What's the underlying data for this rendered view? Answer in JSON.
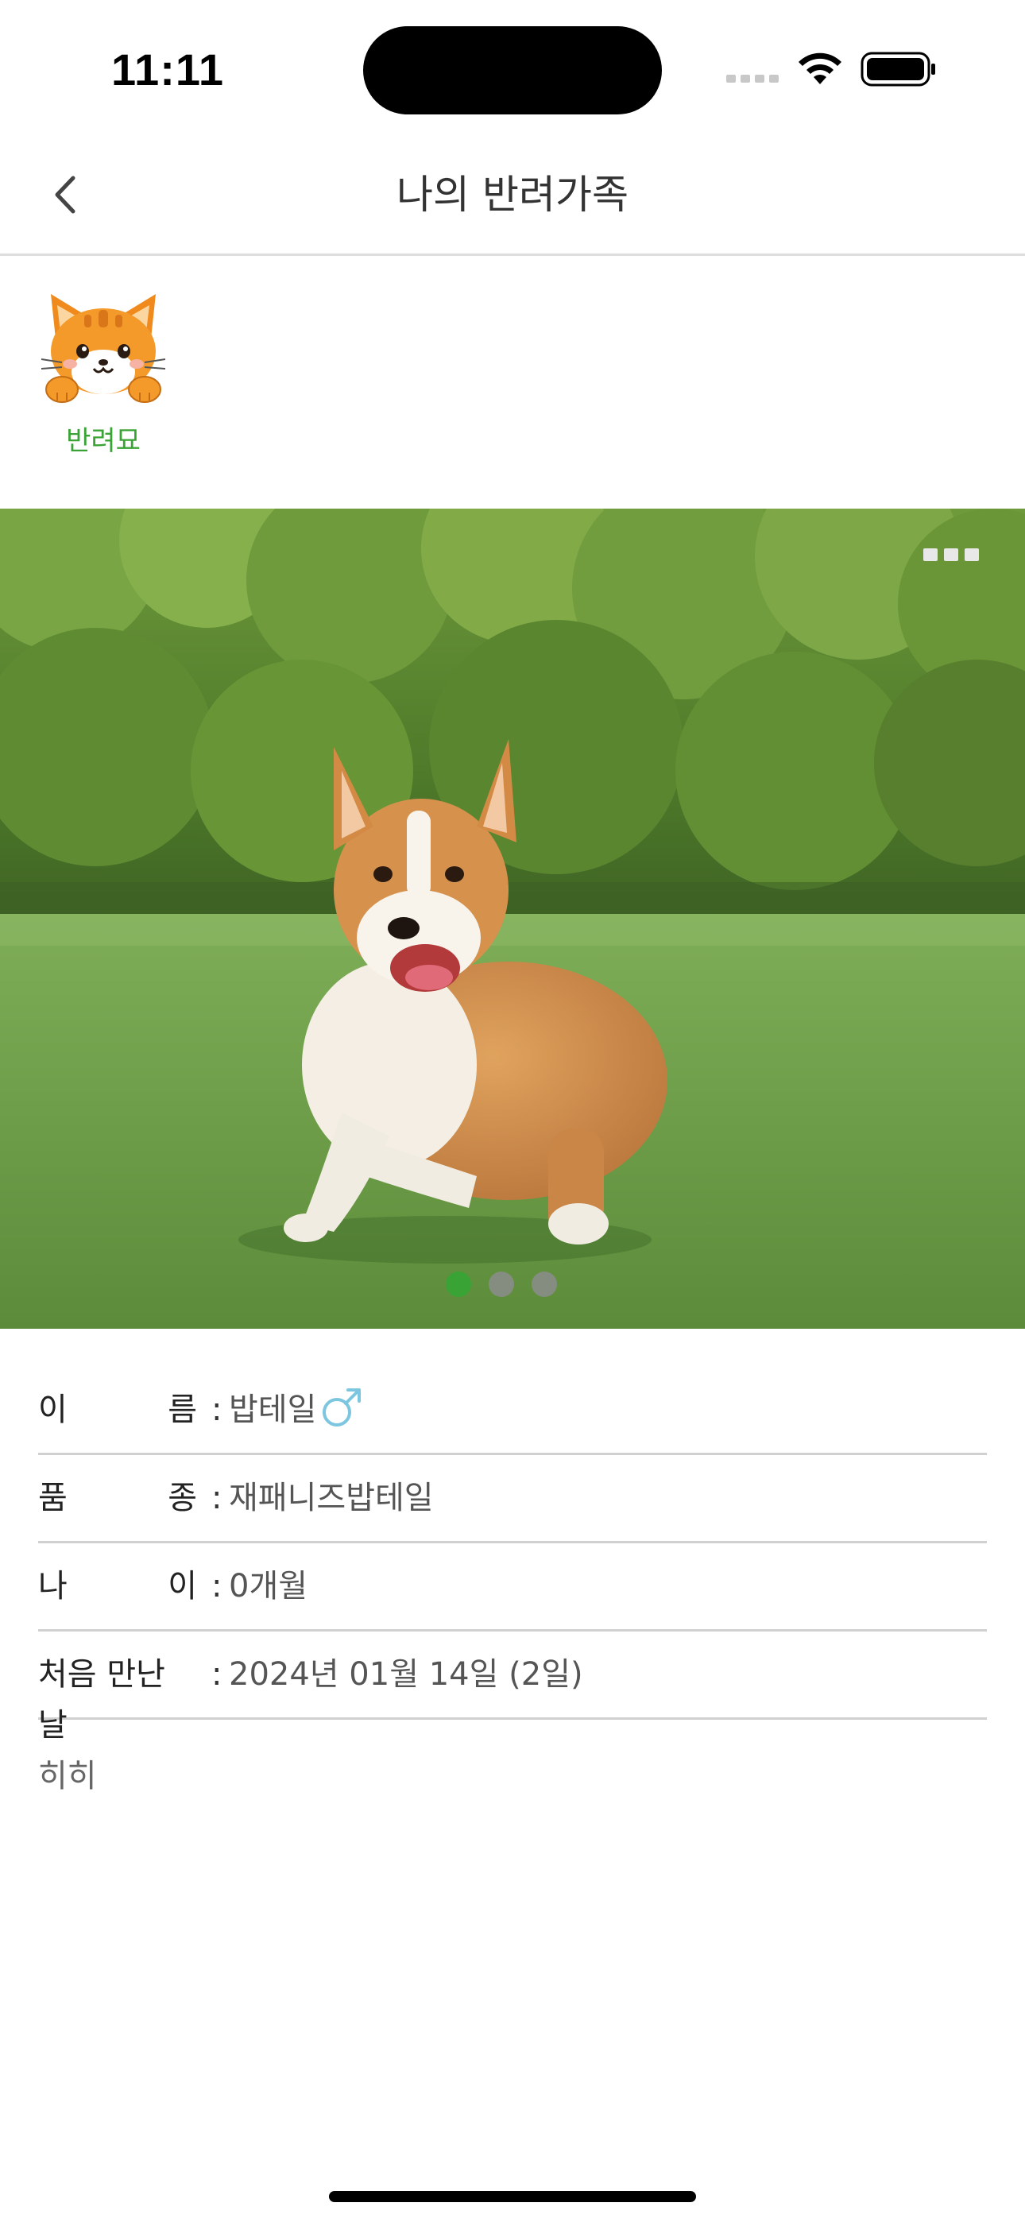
{
  "status_bar": {
    "time": "11:11"
  },
  "header": {
    "title": "나의 반려가족"
  },
  "pet_tabs": [
    {
      "label": "반려묘",
      "selected": true,
      "icon": "cat-face-icon"
    }
  ],
  "carousel": {
    "page_count": 3,
    "current_page": 1,
    "active_color": "#3aa335",
    "inactive_color": "#9a9a9a"
  },
  "pet_info": {
    "name_label": [
      "이",
      "름"
    ],
    "name_value": "밥테일",
    "gender": "male",
    "gender_color": "#7cc6e0",
    "breed_label": [
      "품",
      "종"
    ],
    "breed_value": "재패니즈밥테일",
    "age_label": [
      "나",
      "이"
    ],
    "age_value": "0개월",
    "met_label": "처음 만난 날",
    "met_value": "2024년 01월 14일  (2일)",
    "colon": ":",
    "memo": "히히"
  },
  "colors": {
    "accent_green": "#3aa335",
    "divider": "#d0d0d0"
  }
}
